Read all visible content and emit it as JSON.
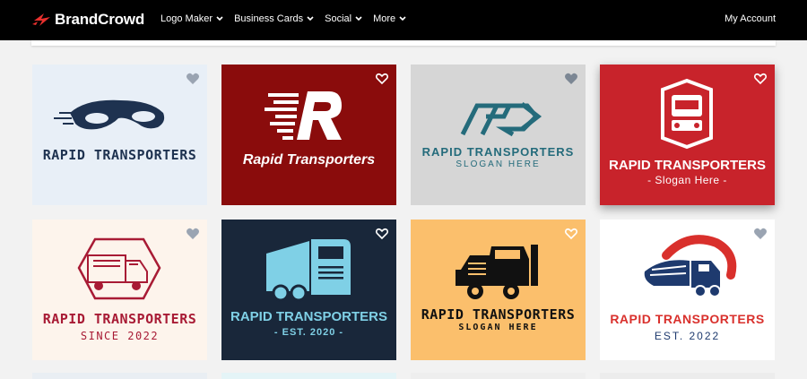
{
  "nav": {
    "brand": "BrandCrowd",
    "menu": [
      "Logo Maker",
      "Business Cards",
      "Social",
      "More"
    ],
    "account": "My Account"
  },
  "colors": {
    "navbar": "#000000",
    "page_bg": "#f2f2f2",
    "brand_red": "#e8302e"
  },
  "logos": [
    {
      "title": "RAPID TRANSPORTERS",
      "slogan": "",
      "bg": "#e8eff7",
      "color": "#1e3250",
      "icon": "sports-car-icon"
    },
    {
      "title": "Rapid Transporters",
      "slogan": "",
      "bg": "#8a0c0c",
      "color": "#ffffff",
      "icon": "speed-letter-r-icon"
    },
    {
      "title": "RAPID TRANSPORTERS",
      "slogan": "SLOGAN HERE",
      "bg": "#d6d6d6",
      "color": "#246b7b",
      "icon": "double-r-arrow-icon"
    },
    {
      "title": "RAPID TRANSPORTERS",
      "slogan": "- Slogan Here -",
      "bg": "#c8232b",
      "color": "#ffffff",
      "icon": "bus-front-icon"
    },
    {
      "title": "RAPID TRANSPORTERS",
      "slogan": "SINCE 2022",
      "bg": "#fdf4ec",
      "color": "#a81b35",
      "icon": "truck-hexagon-icon"
    },
    {
      "title": "RAPID TRANSPORTERS",
      "slogan": "- EST. 2020 -",
      "bg": "#19273a",
      "color": "#7fd0e6",
      "icon": "box-truck-icon"
    },
    {
      "title": "RAPID TRANSPORTERS",
      "slogan": "SLOGAN HERE",
      "bg": "#fbbf6c",
      "color": "#111111",
      "icon": "semi-truck-icon"
    },
    {
      "title": "RAPID TRANSPORTERS",
      "slogan": "EST. 2022",
      "bg": "#ffffff",
      "color": "#d9302c",
      "icon": "delivery-truck-swoosh-icon"
    }
  ]
}
